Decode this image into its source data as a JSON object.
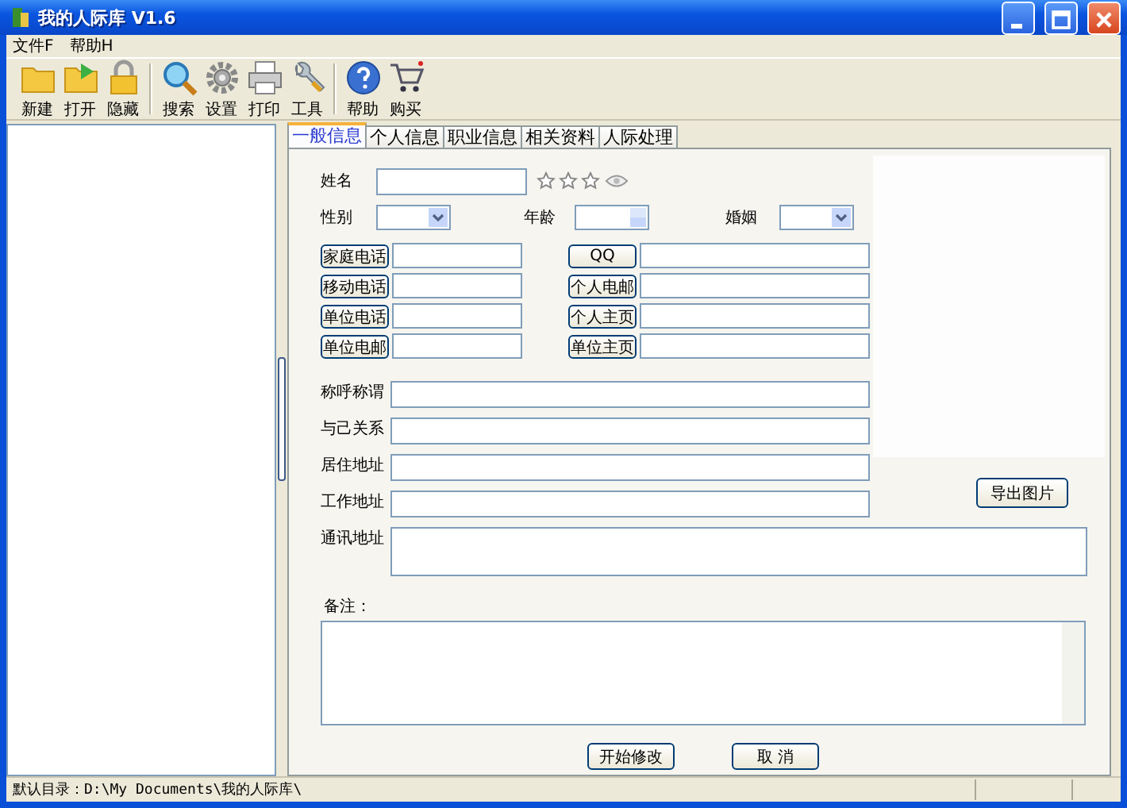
{
  "window": {
    "title": "我的人际库 V1.6"
  },
  "menu": [
    "文件F",
    "帮助H"
  ],
  "toolbar": [
    [
      {
        "label": "新建",
        "kind": "folder"
      },
      {
        "label": "打开",
        "kind": "open"
      },
      {
        "label": "隐藏",
        "kind": "lock"
      }
    ],
    [
      {
        "label": "搜索",
        "kind": "search"
      },
      {
        "label": "设置",
        "kind": "gear"
      },
      {
        "label": "打印",
        "kind": "printer"
      },
      {
        "label": "工具",
        "kind": "wrench"
      }
    ],
    [
      {
        "label": "帮助",
        "kind": "help"
      },
      {
        "label": "购买",
        "kind": "cart"
      }
    ]
  ],
  "tabs": [
    {
      "label": "一般信息",
      "selected": true
    },
    {
      "label": "个人信息",
      "selected": false
    },
    {
      "label": "职业信息",
      "selected": false
    },
    {
      "label": "相关资料",
      "selected": false
    },
    {
      "label": "人际处理",
      "selected": false
    }
  ],
  "form": {
    "name_label": "姓名",
    "stars": 0,
    "gender_label": "性别",
    "age_label": "年龄",
    "marriage_label": "婚姻",
    "contacts_left": [
      "家庭电话",
      "移动电话",
      "单位电话",
      "单位电邮"
    ],
    "contacts_right": [
      "QQ",
      "个人电邮",
      "个人主页",
      "单位主页"
    ],
    "fields": [
      "称呼称谓",
      "与己关系",
      "居住地址",
      "工作地址"
    ],
    "address_label": "通讯地址",
    "export_button": "导出图片",
    "remark_label": "备注：",
    "actions": [
      "开始修改",
      "取 消"
    ]
  },
  "status_bar": "默认目录：D:\\My Documents\\我的人际库\\"
}
